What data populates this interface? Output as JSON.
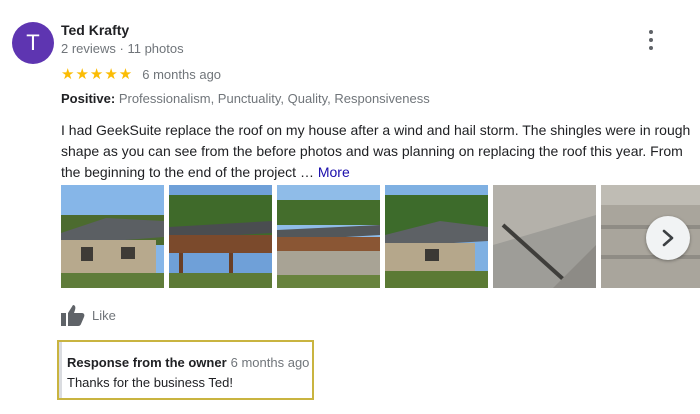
{
  "reviewer": {
    "initial": "T",
    "avatar_color": "#5e35b1",
    "name": "Ted Krafty",
    "meta": "2 reviews · 11 photos"
  },
  "rating": {
    "stars": "★★★★★",
    "value": 5,
    "max": 5,
    "age": "6 months ago"
  },
  "positive": {
    "label": "Positive:",
    "items": "Professionalism, Punctuality, Quality, Responsiveness"
  },
  "review": {
    "text": "I had GeekSuite replace the roof on my house after a wind and hail storm. The shingles were in rough shape as you can see from the before photos and was planning on replacing the roof this year. From the beginning to the end of the project … ",
    "more_label": "More"
  },
  "photos": [
    {
      "subject": "house-side"
    },
    {
      "subject": "deck-front"
    },
    {
      "subject": "deck-back"
    },
    {
      "subject": "house-trees"
    },
    {
      "subject": "shingles-valley"
    },
    {
      "subject": "shingles-closeup"
    }
  ],
  "like": {
    "label": "Like"
  },
  "owner_response": {
    "title": "Response from the owner",
    "age": "6 months ago",
    "text": "Thanks for the business Ted!"
  },
  "colors": {
    "star": "#fbbc04",
    "link": "#1a0dab",
    "highlight_border": "#c9b440"
  }
}
